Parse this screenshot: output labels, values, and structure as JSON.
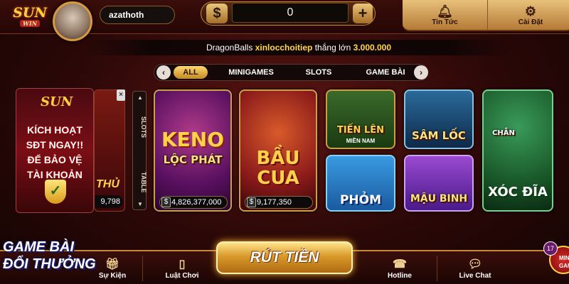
{
  "header": {
    "logo_text": "SUN",
    "logo_sub": "WIN",
    "username": "azathoth",
    "currency_icon": "$",
    "balance": "0",
    "add_icon": "+",
    "notice_label": "Tin Tức",
    "settings_label": "Cài Đặt"
  },
  "marquee": {
    "game": "DragonBalls",
    "player": "xinlocchoitiep",
    "verb": "thắng lớn",
    "amount": "3.000.000"
  },
  "tabs": {
    "prev_icon": "‹",
    "next_icon": "›",
    "items": [
      "ALL",
      "MINIGAMES",
      "SLOTS",
      "GAME BÀI"
    ],
    "active": "ALL"
  },
  "promo": {
    "logo": "SUN",
    "line1": "KÍCH HOẠT",
    "line2": "SĐT NGAY!!",
    "line3": "ĐỂ BẢO VỆ",
    "line4": "TÀI KHOẢN"
  },
  "peek_card": {
    "title": "THỦ",
    "jackpot": "9,798",
    "close_icon": "×"
  },
  "side_tabs": {
    "slots": "SLOTS",
    "table": "TABLE"
  },
  "games": {
    "keno": {
      "title1": "KENO",
      "title2": "LỘC PHÁT",
      "jackpot": "4,826,377,000"
    },
    "baucua": {
      "title1": "BẦU",
      "title2": "CUA",
      "jackpot": "9,177,350"
    },
    "tienlen": {
      "title": "TIẾN LÊN",
      "sub": "MIỀN NAM"
    },
    "samloc": {
      "title": "SÂM LỐC"
    },
    "xocdia": {
      "title": "XÓC ĐĨA",
      "tag": "CHẴN"
    },
    "phom": {
      "title": "PHỎM"
    },
    "maubinh": {
      "title": "MẬU BINH"
    }
  },
  "bottom": {
    "event_label": "Sự Kiện",
    "rules_label": "Luật Chơi",
    "withdraw_label": "RÚT TIỀN",
    "hotline_label": "Hotline",
    "livechat_label": "Live Chat",
    "mini_badge": "17",
    "mini_label": "MINI GAME"
  },
  "watermark": {
    "line1": "GAME BÀI",
    "line2": "ĐỔI THƯỞNG"
  },
  "colors": {
    "gold": "#ffd84a",
    "accent": "#c48a3a",
    "background": "#2a0807"
  }
}
